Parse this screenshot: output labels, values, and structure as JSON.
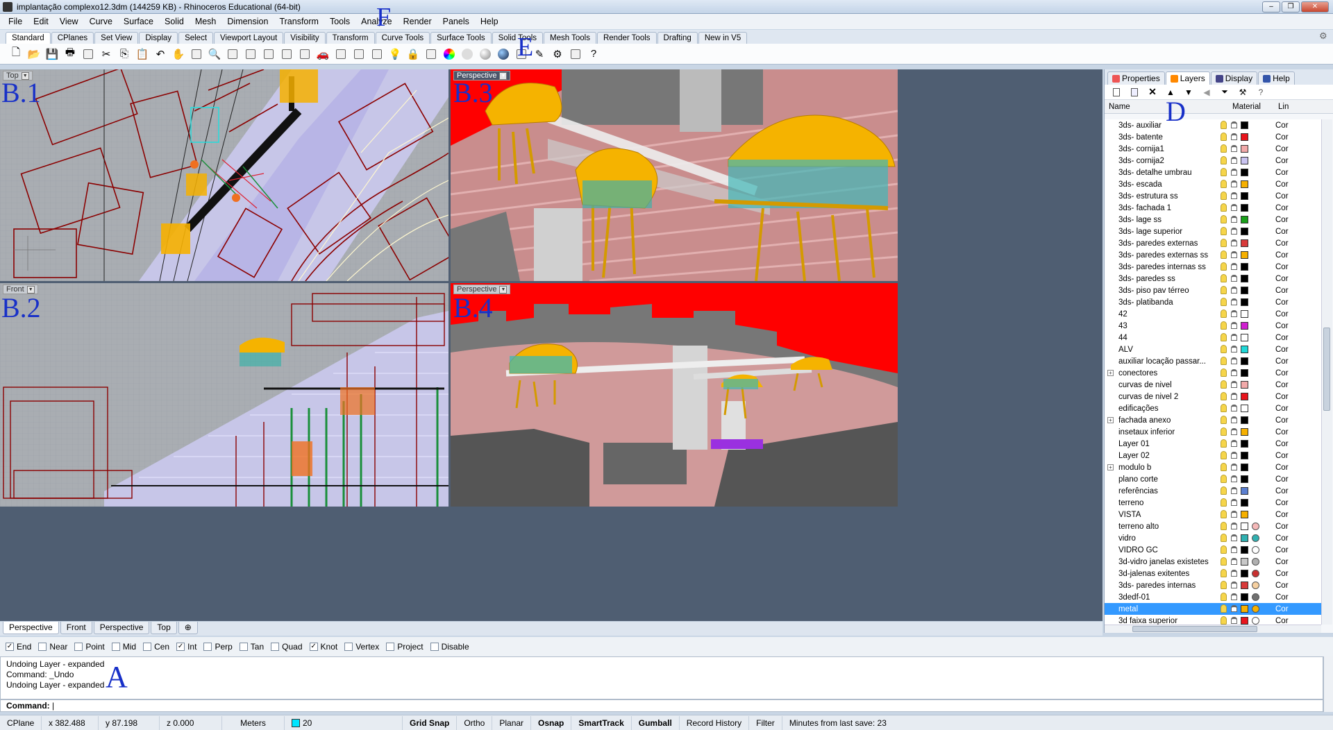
{
  "window": {
    "title": "implantação complexo12.3dm (144259 KB) - Rhinoceros Educational (64-bit)"
  },
  "menu": [
    "File",
    "Edit",
    "View",
    "Curve",
    "Surface",
    "Solid",
    "Mesh",
    "Dimension",
    "Transform",
    "Tools",
    "Analyze",
    "Render",
    "Panels",
    "Help"
  ],
  "toolbar_tabs": [
    "Standard",
    "CPlanes",
    "Set View",
    "Display",
    "Select",
    "Viewport Layout",
    "Visibility",
    "Transform",
    "Curve Tools",
    "Surface Tools",
    "Solid Tools",
    "Mesh Tools",
    "Render Tools",
    "Drafting",
    "New in V5"
  ],
  "toolbar_icons": [
    "new-file-icon",
    "open-icon",
    "save-icon",
    "print-icon",
    "import-icon",
    "cut-icon",
    "copy-icon",
    "paste-icon",
    "undo-icon",
    "pan-icon",
    "move-view-icon",
    "zoom-icon",
    "zoom-window-icon",
    "zoom-extents-icon",
    "zoom-selected-icon",
    "rotate-view-icon",
    "four-view-icon",
    "car-icon",
    "hide-icon",
    "show-icon",
    "select-point-icon",
    "light-icon",
    "lock-icon",
    "layer-icon",
    "color-icon",
    "wireframe-sphere-icon",
    "shaded-sphere-icon",
    "rendered-sphere-icon",
    "render-icon",
    "pen-icon",
    "options-icon",
    "dimension-icon",
    "help-icon"
  ],
  "markers": {
    "A": "A",
    "D": "D",
    "E": "E",
    "F": "F",
    "B1": "B.1",
    "B2": "B.2",
    "B3": "B.3",
    "B4": "B.4"
  },
  "viewports": {
    "top": "Top",
    "front": "Front",
    "persp1": "Perspective",
    "persp2": "Perspective"
  },
  "viewport_tabs": [
    "Perspective",
    "Front",
    "Perspective",
    "Top"
  ],
  "osnaps": [
    {
      "label": "End",
      "checked": true
    },
    {
      "label": "Near",
      "checked": false
    },
    {
      "label": "Point",
      "checked": false
    },
    {
      "label": "Mid",
      "checked": false
    },
    {
      "label": "Cen",
      "checked": false
    },
    {
      "label": "Int",
      "checked": true
    },
    {
      "label": "Perp",
      "checked": false
    },
    {
      "label": "Tan",
      "checked": false
    },
    {
      "label": "Quad",
      "checked": false
    },
    {
      "label": "Knot",
      "checked": true
    },
    {
      "label": "Vertex",
      "checked": false
    },
    {
      "label": "Project",
      "checked": false
    },
    {
      "label": "Disable",
      "checked": false
    }
  ],
  "command": {
    "history": [
      "Undoing Layer - expanded",
      "Command: _Undo",
      "Undoing Layer - expanded"
    ],
    "prompt": "Command:"
  },
  "status": {
    "cplane": "CPlane",
    "x": "x 382.488",
    "y": "y 87.198",
    "z": "z 0.000",
    "units": "Meters",
    "layer_num": "20",
    "layer_color": "#00e5ff",
    "grid_snap": "Grid Snap",
    "ortho": "Ortho",
    "planar": "Planar",
    "osnap": "Osnap",
    "smarttrack": "SmartTrack",
    "gumball": "Gumball",
    "record_history": "Record History",
    "filter": "Filter",
    "minutes": "Minutes from last save: 23"
  },
  "panel": {
    "tabs": [
      "Properties",
      "Layers",
      "Display",
      "Help"
    ],
    "col_name": "Name",
    "col_material": "Material",
    "col_lin": "Lin",
    "layers": [
      {
        "name": "3ds- auxiliar",
        "color": "#000000",
        "lin": "Cor"
      },
      {
        "name": "3ds- batente",
        "color": "#e8141c",
        "lin": "Cor"
      },
      {
        "name": "3ds- cornija1",
        "color": "#f1a9a9",
        "lin": "Cor"
      },
      {
        "name": "3ds- cornija2",
        "color": "#c9c3f0",
        "lin": "Cor"
      },
      {
        "name": "3ds- detalhe umbrau",
        "color": "#000000",
        "lin": "Cor"
      },
      {
        "name": "3ds- escada",
        "color": "#f6b000",
        "lin": "Cor"
      },
      {
        "name": "3ds- estrutura ss",
        "color": "#000000",
        "lin": "Cor"
      },
      {
        "name": "3ds- fachada 1",
        "color": "#000000",
        "lin": "Cor"
      },
      {
        "name": "3ds- lage ss",
        "color": "#1aa01a",
        "lin": "Cor"
      },
      {
        "name": "3ds- lage superior",
        "color": "#000000",
        "lin": "Cor"
      },
      {
        "name": "3ds- paredes externas",
        "color": "#d83a3a",
        "lin": "Cor"
      },
      {
        "name": "3ds- paredes externas ss",
        "color": "#f6b000",
        "lin": "Cor"
      },
      {
        "name": "3ds- paredes internas ss",
        "color": "#000000",
        "lin": "Cor"
      },
      {
        "name": "3ds- paredes ss",
        "color": "#000000",
        "lin": "Cor"
      },
      {
        "name": "3ds- piso pav térreo",
        "color": "#000000",
        "lin": "Cor"
      },
      {
        "name": "3ds- platibanda",
        "color": "#000000",
        "lin": "Cor"
      },
      {
        "name": "42",
        "color": "#ffffff",
        "lin": "Cor"
      },
      {
        "name": "43",
        "color": "#d020d0",
        "lin": "Cor"
      },
      {
        "name": "44",
        "color": "#ffffff",
        "lin": "Cor"
      },
      {
        "name": "ALV",
        "color": "#20d8d8",
        "lin": "Cor"
      },
      {
        "name": "auxiliar locação passar...",
        "color": "#000000",
        "lin": "Cor"
      },
      {
        "name": "conectores",
        "color": "#000000",
        "lin": "Cor",
        "expand": true
      },
      {
        "name": "curvas de nivel",
        "color": "#f1a9a9",
        "lin": "Cor"
      },
      {
        "name": "curvas de nivel 2",
        "color": "#e8141c",
        "lin": "Cor"
      },
      {
        "name": "edificações",
        "color": "#ffffff",
        "lin": "Cor"
      },
      {
        "name": "fachada anexo",
        "color": "#000000",
        "lin": "Cor",
        "expand": true
      },
      {
        "name": "insetaux inferior",
        "color": "#f6b000",
        "lin": "Cor"
      },
      {
        "name": "Layer 01",
        "color": "#000000",
        "lin": "Cor"
      },
      {
        "name": "Layer 02",
        "color": "#000000",
        "lin": "Cor"
      },
      {
        "name": "modulo b",
        "color": "#000000",
        "lin": "Cor",
        "expand": true
      },
      {
        "name": "plano corte",
        "color": "#000000",
        "lin": "Cor"
      },
      {
        "name": "referências",
        "color": "#5b7fd0",
        "lin": "Cor"
      },
      {
        "name": "terreno",
        "color": "#000000",
        "lin": "Cor"
      },
      {
        "name": "VISTA",
        "color": "#f6b000",
        "lin": "Cor"
      },
      {
        "name": "terreno alto",
        "color": "#ffffff",
        "mat": "#f5b8b8",
        "lin": "Cor"
      },
      {
        "name": "vidro",
        "color": "#30b0b0",
        "mat": "#30b0b0",
        "lin": "Cor"
      },
      {
        "name": "VIDRO GC",
        "color": "#000000",
        "mat": "#ffffff",
        "lin": "Cor"
      },
      {
        "name": "3d-vidro janelas existetes",
        "color": "#c8c8c8",
        "mat": "#b0b0b0",
        "lin": "Cor"
      },
      {
        "name": "3d-jalenas exitentes",
        "color": "#000000",
        "mat": "#c83030",
        "lin": "Cor"
      },
      {
        "name": "3ds- paredes internas",
        "color": "#d83a3a",
        "mat": "#f6d0a0",
        "lin": "Cor"
      },
      {
        "name": "3dedf-01",
        "color": "#000000",
        "mat": "#707070",
        "lin": "Cor"
      },
      {
        "name": "metal",
        "color": "#f6b000",
        "mat": "#f6b000",
        "lin": "Cor",
        "selected": true
      },
      {
        "name": "3d faixa superior",
        "color": "#e8141c",
        "mat": "#ffffff",
        "lin": "Cor"
      }
    ]
  }
}
